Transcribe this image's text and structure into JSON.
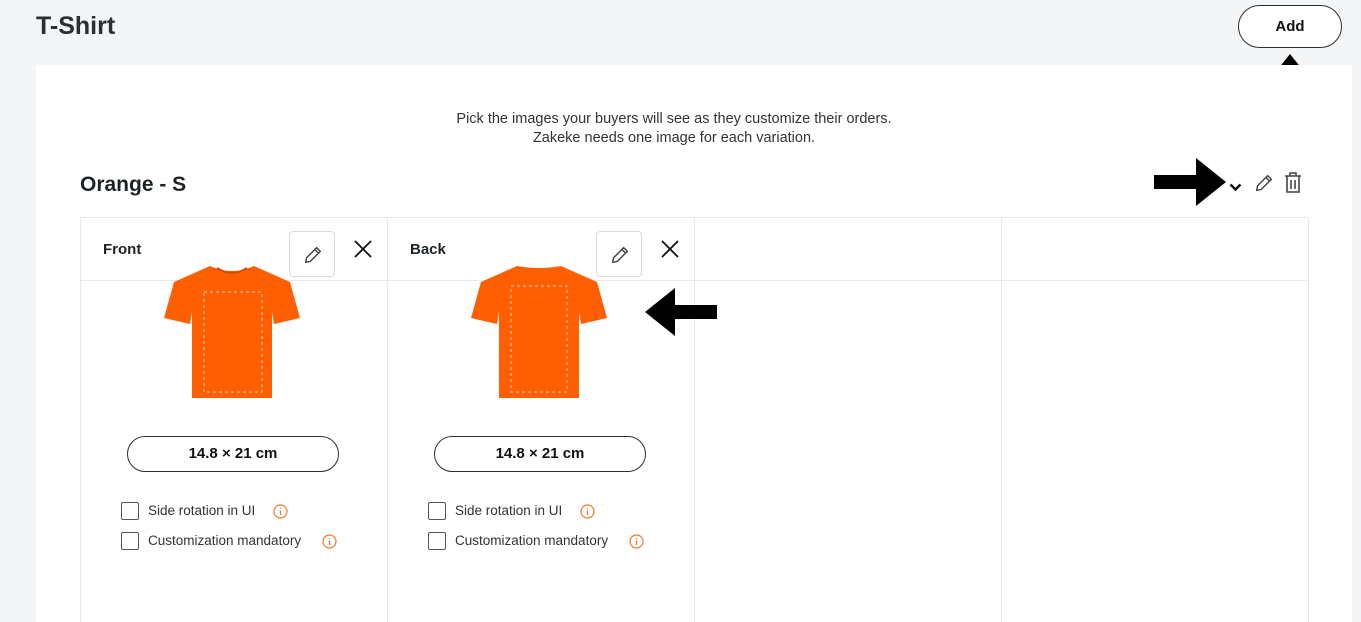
{
  "header": {
    "title": "T-Shirt",
    "add_label": "Add"
  },
  "intro": {
    "line1": "Pick the images your buyers will see as they customize their orders.",
    "line2": "Zakeke needs one image for each variation."
  },
  "variation": {
    "title": "Orange - S",
    "actions": [
      "chevron-down-icon",
      "pencil-icon",
      "trash-icon"
    ]
  },
  "sides": [
    {
      "name": "Front",
      "size": "14.8 × 21 cm",
      "options": [
        {
          "label": "Side rotation in UI",
          "checked": false
        },
        {
          "label": "Customization mandatory",
          "checked": false
        }
      ]
    },
    {
      "name": "Back",
      "size": "14.8 × 21 cm",
      "options": [
        {
          "label": "Side rotation in UI",
          "checked": false
        },
        {
          "label": "Customization mandatory",
          "checked": false
        }
      ]
    }
  ],
  "colors": {
    "shirt": "#ff5f00",
    "info": "#f07a2a",
    "text": "#1d2327",
    "border": "#e6e8ea",
    "background": "#f4f5f6"
  }
}
